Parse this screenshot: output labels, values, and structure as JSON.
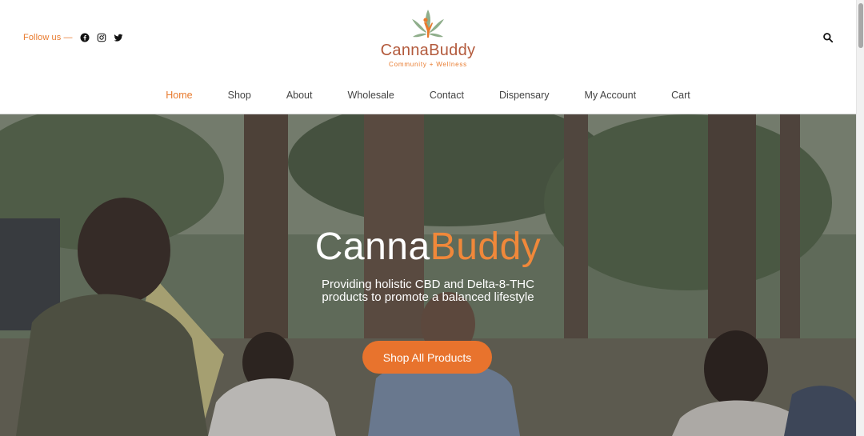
{
  "header": {
    "follow_label": "Follow us —",
    "social": [
      {
        "name": "facebook-icon"
      },
      {
        "name": "instagram-icon"
      },
      {
        "name": "twitter-icon"
      }
    ],
    "logo": {
      "name": "CannaBuddy",
      "tagline": "Community + Wellness"
    },
    "search_icon": "search-icon"
  },
  "nav": {
    "items": [
      {
        "label": "Home",
        "active": true
      },
      {
        "label": "Shop"
      },
      {
        "label": "About"
      },
      {
        "label": "Wholesale"
      },
      {
        "label": "Contact"
      },
      {
        "label": "Dispensary"
      },
      {
        "label": "My Account"
      },
      {
        "label": "Cart"
      }
    ]
  },
  "hero": {
    "title_part1": "Canna",
    "title_part2": "Buddy",
    "subtitle_line1": "Providing holistic CBD and Delta-8-THC",
    "subtitle_line2": "products to promote a balanced lifestyle",
    "cta_label": "Shop All Products"
  },
  "colors": {
    "accent": "#e87a2d",
    "logo_text": "#b35a3c",
    "leaf_green": "#8fae8b"
  }
}
